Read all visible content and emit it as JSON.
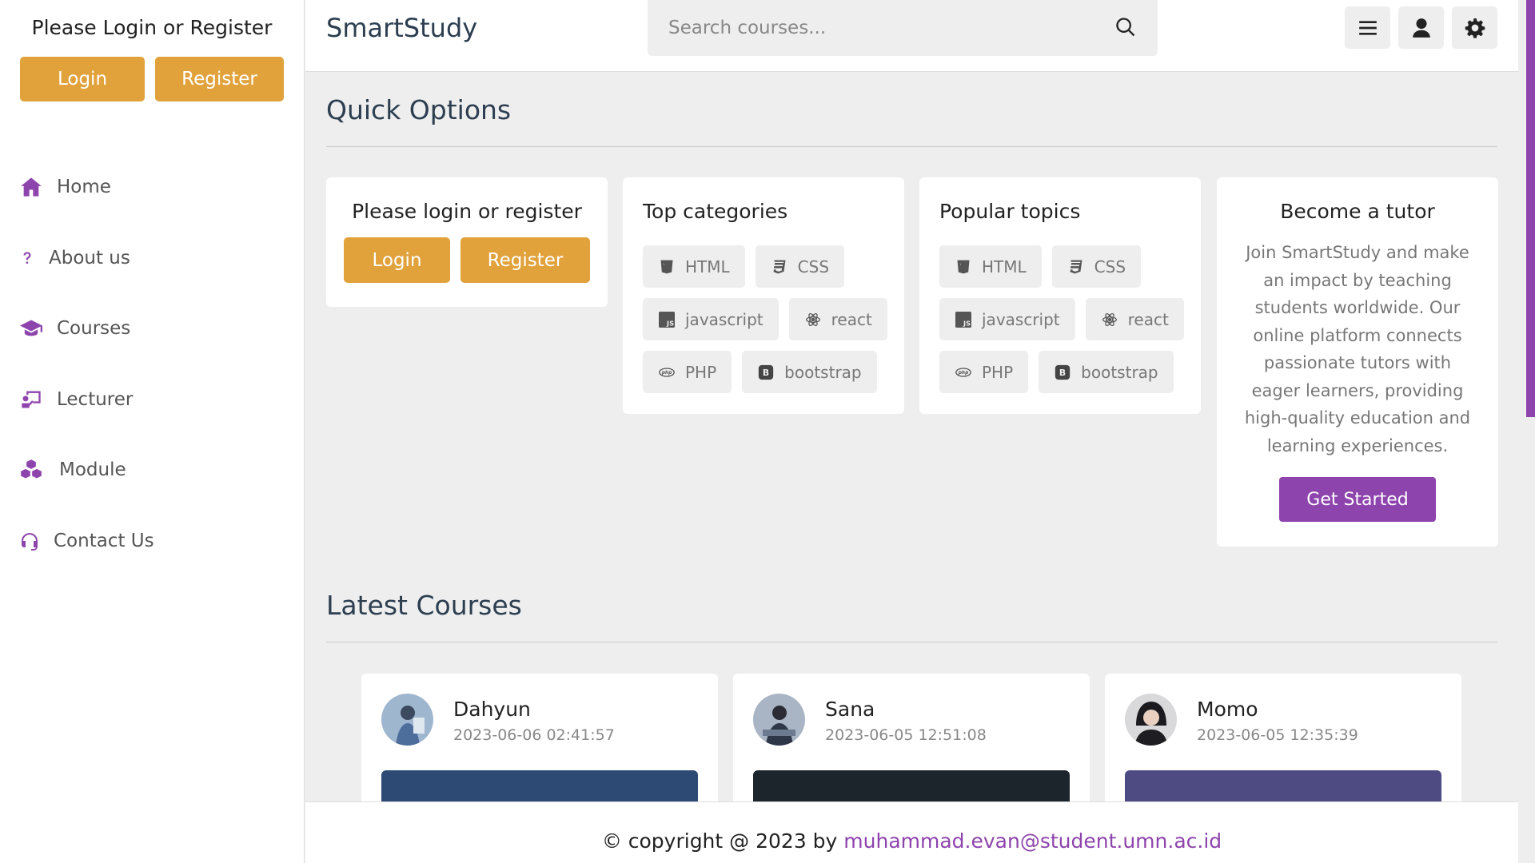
{
  "sidebar": {
    "login_prompt": "Please Login or Register",
    "login_label": "Login",
    "register_label": "Register",
    "nav": [
      {
        "label": "Home",
        "icon": "home-icon"
      },
      {
        "label": "About us",
        "icon": "question-icon"
      },
      {
        "label": "Courses",
        "icon": "graduation-cap-icon"
      },
      {
        "label": "Lecturer",
        "icon": "chalkboard-teacher-icon"
      },
      {
        "label": "Module",
        "icon": "cubes-icon"
      },
      {
        "label": "Contact Us",
        "icon": "headset-icon"
      }
    ]
  },
  "header": {
    "brand": "SmartStudy",
    "search_placeholder": "Search courses...",
    "buttons": [
      "menu-icon",
      "user-icon",
      "gear-icon"
    ]
  },
  "quick_options": {
    "title": "Quick Options",
    "login_box": {
      "title": "Please login or register",
      "login_label": "Login",
      "register_label": "Register"
    },
    "top_categories": {
      "title": "Top categories",
      "tags": [
        "HTML",
        "CSS",
        "javascript",
        "react",
        "PHP",
        "bootstrap"
      ]
    },
    "popular_topics": {
      "title": "Popular topics",
      "tags": [
        "HTML",
        "CSS",
        "javascript",
        "react",
        "PHP",
        "bootstrap"
      ]
    },
    "tutor": {
      "title": "Become a tutor",
      "text": "Join SmartStudy and make an impact by teaching students worldwide. Our online platform connects passionate tutors with eager learners, providing high-quality education and learning experiences.",
      "button": "Get Started"
    }
  },
  "latest_courses": {
    "title": "Latest Courses",
    "items": [
      {
        "name": "Dahyun",
        "date": "2023-06-06 02:41:57",
        "thumb_color": "#2c4a73"
      },
      {
        "name": "Sana",
        "date": "2023-06-05 12:51:08",
        "thumb_color": "#1c242c"
      },
      {
        "name": "Momo",
        "date": "2023-06-05 12:35:39",
        "thumb_color": "#4e4a82"
      }
    ]
  },
  "footer": {
    "prefix": "© copyright @ 2023 by",
    "email": "muhammad.evan@student.umn.ac.id"
  },
  "colors": {
    "accent": "#8e44ad",
    "orange": "#e1a23b"
  }
}
